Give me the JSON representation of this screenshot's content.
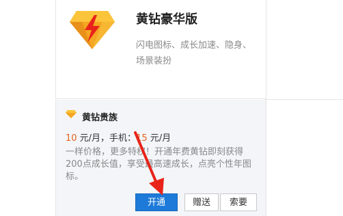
{
  "top_card": {
    "title": "黄钻豪华版",
    "desc": "闪电图标、成长加速、隐身、场景装扮",
    "icon": "yellow-diamond-lightning-icon"
  },
  "vip": {
    "icon": "small-yellow-diamond-icon",
    "title": "黄钻贵族",
    "price_monthly": "10",
    "price_unit": " 元/月，手机：",
    "price_mobile": "15",
    "price_mobile_unit": " 元/月",
    "desc": "一样价格，更多特权！开通年费黄钻即刻获得200点成长值，享受最高速成长，点亮个性年图标。"
  },
  "buttons": {
    "open": "开通",
    "gift": "赠送",
    "ask": "索要"
  },
  "colors": {
    "accent": "#1d7ad9",
    "price": "#e5601e",
    "arrow": "#e8231a",
    "diamond": "#f5a623"
  }
}
